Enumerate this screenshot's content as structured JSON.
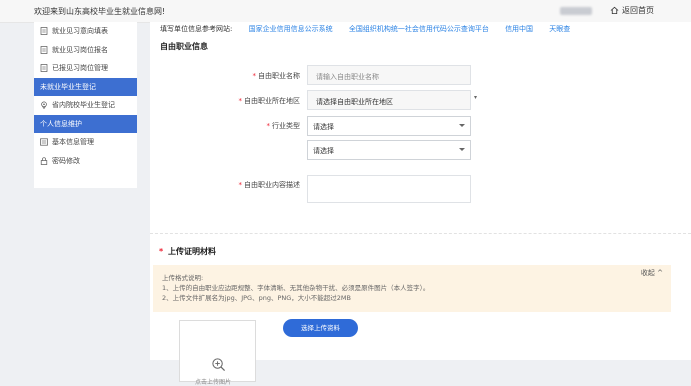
{
  "topbar": {
    "welcome": "欢迎来到山东高校毕业生就业信息网!",
    "home_label": "返回首页"
  },
  "sidebar": {
    "items": [
      {
        "label": "就业见习意向填表",
        "icon": "document-icon",
        "active": false,
        "head": false
      },
      {
        "label": "就业见习岗位报名",
        "icon": "document-icon",
        "active": false,
        "head": false
      },
      {
        "label": "已报见习岗位管理",
        "icon": "document-icon",
        "active": false,
        "head": false
      },
      {
        "label": "未就业毕业生登记",
        "icon": "",
        "active": true,
        "head": false
      },
      {
        "label": "省内院校毕业生登记",
        "icon": "pin-icon",
        "active": false,
        "head": false
      },
      {
        "label": "个人信息维护",
        "icon": "",
        "active": false,
        "head": true
      },
      {
        "label": "基本信息管理",
        "icon": "list-icon",
        "active": false,
        "head": false
      },
      {
        "label": "密码修改",
        "icon": "lock-icon",
        "active": false,
        "head": false
      }
    ]
  },
  "refs": {
    "prefix": "填写单位信息参考网站:",
    "links": [
      "国家企业信用信息公示系统",
      "全国组织机构统一社会信用代码公示查询平台",
      "信用中国",
      "天眼查"
    ]
  },
  "form": {
    "section_title": "自由职业信息",
    "name_label": "自由职业名称",
    "name_placeholder": "请输入自由职业名称",
    "region_label": "自由职业所在地区",
    "region_placeholder": "请选择自由职业所在地区",
    "industry_label": "行业类型",
    "industry_select1": "请选择",
    "industry_select2": "请选择",
    "desc_label": "自由职业内容描述",
    "required_mark": "*"
  },
  "upload": {
    "title": "上传证明材料",
    "collapse": "收起",
    "notice_title": "上传格式说明:",
    "notice_line1": "1、上传的自由职业应边距规整、字体清晰、无其他杂物干扰、必须是原件图片（本人签字）。",
    "notice_line2": "2、上传文件扩展名为jpg、JPG、png、PNG，大小不能超过2MB",
    "button": "选择上传资料",
    "box_caption": "点击上传图片"
  }
}
